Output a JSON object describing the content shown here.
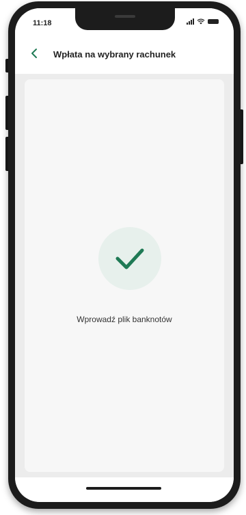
{
  "status_bar": {
    "time": "11:18"
  },
  "nav": {
    "title": "Wpłata na wybrany rachunek",
    "back_icon": "chevron-left-icon"
  },
  "content": {
    "success_icon": "checkmark-icon",
    "message": "Wprowadź plik banknotów"
  },
  "colors": {
    "accent": "#1f7a55",
    "check_circle_bg": "#e7f0ec"
  }
}
